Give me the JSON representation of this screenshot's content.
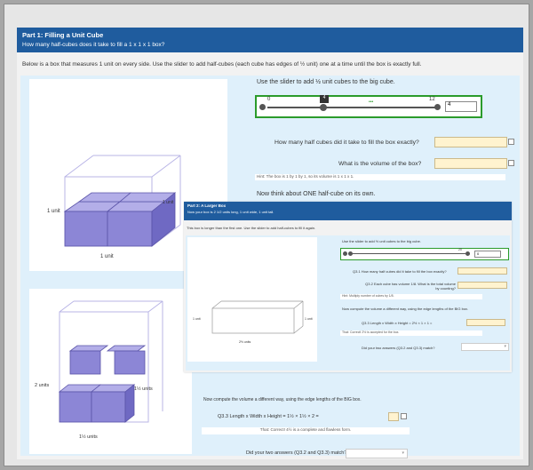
{
  "part1": {
    "title": "Part 1: Filling a Unit Cube",
    "subtitle": "How many half-cubes does it take to fill a 1 x 1 x 1 box?",
    "intro": "Below is a box that measures 1 unit on every side. Use the slider to add half-cubes (each cube has edges of ½ unit) one at a time until the box is exactly full.",
    "cube_label_left": "1 unit",
    "cube_label_bottom": "1 unit",
    "cube_label_right": "1 unit",
    "slider_instruction": "Use the slider to add ½ unit cubes to the big cube.",
    "slider": {
      "min": "0",
      "max": "12",
      "value": "4",
      "tooltip": "4",
      "dots": "•••"
    },
    "q1": "How many half cubes did it take to fill the box exactly?",
    "q2": "What is the volume of the box?",
    "hint": "Hint: The box is 1 by 1 by 1, so its volume is 1 x 1 x 1.",
    "think": "Now think about ONE half-cube on its own.",
    "prism_labels": {
      "left": "2 units",
      "right": "1½ units",
      "bottom": "1½ units"
    }
  },
  "part2": {
    "title": "Part 2: A Larger Box",
    "subtitle": "Now your box is 2 1/2 units long, 1 unit wide, 1 unit tall.",
    "intro": "This box is longer than the first one. Use the slider to add half-cubes to fill it again.",
    "slider_instruction": "Use the slider to add ½ unit cubes to the big cube.",
    "slider": {
      "max": "20",
      "value": "0"
    },
    "q1": "Q3.1 How many half cubes did it take to fill the box exactly?",
    "q2": "Q3.2 Each cube has volume 1/8. What is the total volume by counting?",
    "hint": "Hint: Multiply number of cubes by 1/8.",
    "compute": "Now compute the volume a different way, using the edge lengths of the BIG box.",
    "formula": "Q3.3 Length x Width x Height = 2½ × 1 × 1 =",
    "correct": "That: Correct! 2½ is accepted for the box.",
    "match": "Did your two answers (Q3.2 and Q3.3) match?",
    "box_labels": {
      "left": "1 unit",
      "right": "1 unit",
      "bottom": "2½ units"
    }
  },
  "bottom": {
    "compute": "Now compute the volume a different way, using the edge lengths of the BIG box.",
    "formula": "Q3.3 Length x Width x Height = 1½ × 1½ × 2 =",
    "correct": "That: Correct! 4½ is a complete and flawless form.",
    "match": "Did your two answers (Q3.2 and Q3.3) match?"
  },
  "colors": {
    "header": "#1f5c9e",
    "panel": "#dff0fb",
    "answer": "#fff3cf",
    "cube": "#8c86d6",
    "slider_border": "#2b9b2b"
  }
}
